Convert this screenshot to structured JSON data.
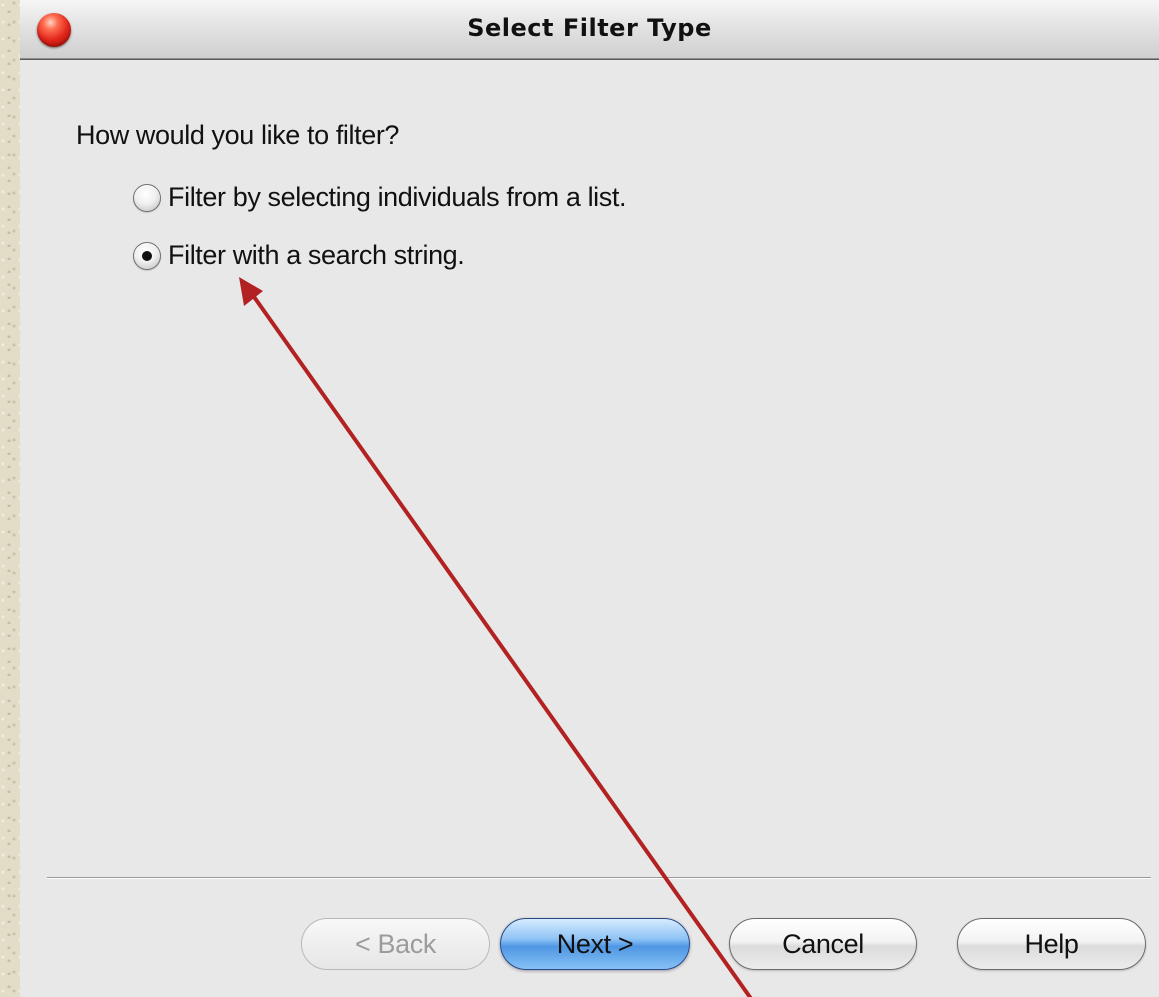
{
  "window": {
    "title": "Select Filter Type"
  },
  "main": {
    "question": "How would you like to filter?",
    "options": [
      {
        "label": "Filter by selecting individuals from a list.",
        "selected": false
      },
      {
        "label": "Filter with a search string.",
        "selected": true
      }
    ]
  },
  "buttons": {
    "back": "< Back",
    "next": "Next >",
    "cancel": "Cancel",
    "help": "Help"
  },
  "colors": {
    "annotation_arrow": "#b22222",
    "close_button": "#e1261b",
    "default_button": "#4f97e3"
  }
}
